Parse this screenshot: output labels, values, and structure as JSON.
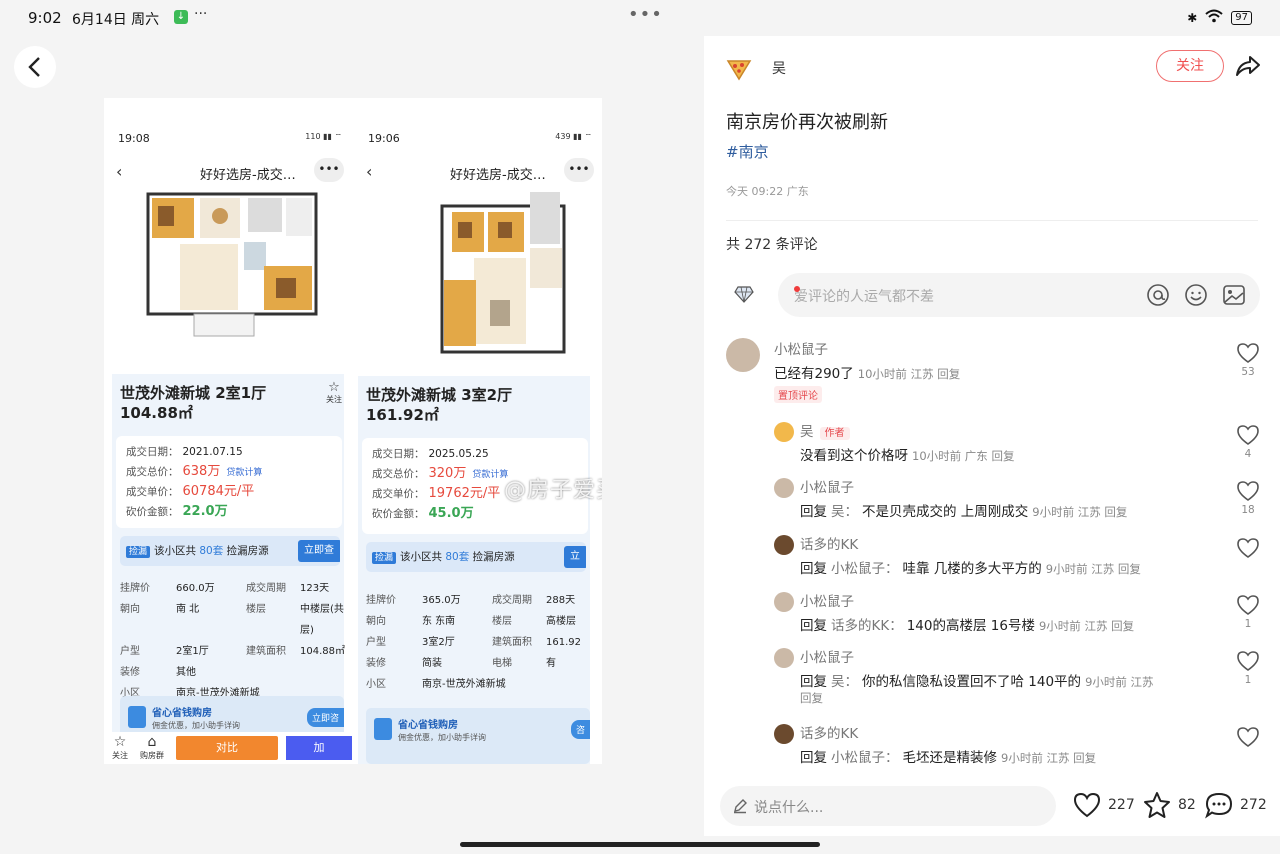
{
  "status_bar": {
    "time": "9:02",
    "date": "6月14日 周六",
    "battery": "97"
  },
  "left": {
    "watermark": "@房子爱买不买",
    "listing_a": {
      "time": "19:08",
      "signal": "110",
      "title": "好好选房-成交…",
      "name": "世茂外滩新城 2室1厅",
      "area": "104.88㎡",
      "follow": "关注",
      "deal_date_label": "成交日期：",
      "deal_date": "2021.07.15",
      "total_label": "成交总价：",
      "total": "638万",
      "loan": "贷款计算",
      "unit_label": "成交单价：",
      "unit": "60784元/平",
      "bargain_label": "砍价金额：",
      "bargain": "22.0万",
      "leak_tag": "捡漏",
      "leak_text_a": "该小区共",
      "leak_num": "80套",
      "leak_text_b": "捡漏房源",
      "leak_btn": "立即查",
      "rows": [
        {
          "k1": "挂牌价",
          "v1": "660.0万",
          "k2": "成交周期",
          "v2": "123天"
        },
        {
          "k1": "朝向",
          "v1": "南 北",
          "k2": "楼层",
          "v2": "中楼层(共"
        },
        {
          "k1": "",
          "v1": "",
          "k2": "",
          "v2": "层)"
        },
        {
          "k1": "户型",
          "v1": "2室1厅",
          "k2": "建筑面积",
          "v2": "104.88㎡"
        },
        {
          "k1": "装修",
          "v1": "其他",
          "k2": "",
          "v2": ""
        },
        {
          "k1": "小区",
          "v1": "南京-世茂外滩新城",
          "k2": "",
          "v2": ""
        }
      ],
      "save_title": "省心省钱购房",
      "save_sub": "佣金优惠，加小助手详询",
      "save_btn": "立即咨",
      "ba_follow": "关注",
      "ba_buy": "购房群",
      "ba_compare": "对比",
      "ba_add": "加"
    },
    "listing_b": {
      "time": "19:06",
      "signal": "439",
      "title": "好好选房-成交…",
      "name": "世茂外滩新城 3室2厅",
      "area": "161.92㎡",
      "deal_date_label": "成交日期：",
      "deal_date": "2025.05.25",
      "total_label": "成交总价：",
      "total": "320万",
      "loan": "贷款计算",
      "unit_label": "成交单价：",
      "unit": "19762元/平",
      "bargain_label": "砍价金额：",
      "bargain": "45.0万",
      "leak_tag": "捡漏",
      "leak_text_a": "该小区共",
      "leak_num": "80套",
      "leak_text_b": "捡漏房源",
      "leak_btn": "立",
      "rows": [
        {
          "k1": "挂牌价",
          "v1": "365.0万",
          "k2": "成交周期",
          "v2": "288天"
        },
        {
          "k1": "朝向",
          "v1": "东 东南",
          "k2": "楼层",
          "v2": "高楼层"
        },
        {
          "k1": "户型",
          "v1": "3室2厅",
          "k2": "建筑面积",
          "v2": "161.92"
        },
        {
          "k1": "装修",
          "v1": "简装",
          "k2": "电梯",
          "v2": "有"
        },
        {
          "k1": "小区",
          "v1": "南京-世茂外滩新城",
          "k2": "",
          "v2": ""
        }
      ],
      "save_title": "省心省钱购房",
      "save_sub": "佣金优惠，加小助手详询",
      "save_btn": "咨"
    }
  },
  "post": {
    "author": "吴",
    "follow_label": "关注",
    "title": "南京房价再次被刷新",
    "tag": "#南京",
    "time": "今天 09:22 广东",
    "comment_count": "共 272 条评论",
    "input_placeholder": "爱评论的人运气都不差"
  },
  "comments": [
    {
      "name": "小松鼠子",
      "text": "已经有290了",
      "meta": "10小时前 江苏  回复",
      "likes": "53",
      "badge": "置顶评论"
    },
    {
      "name": "吴",
      "author_badge": "作者",
      "text": "没看到这个价格呀",
      "meta": "10小时前 广东  回复",
      "likes": "4"
    },
    {
      "name": "小松鼠子",
      "prefix": "回复",
      "reply_to": "吴：",
      "text": "不是贝壳成交的 上周刚成交",
      "meta": "9小时前 江苏  回复",
      "likes": "18"
    },
    {
      "name": "话多的KK",
      "prefix": "回复",
      "reply_to": "小松鼠子：",
      "text": "哇靠 几楼的多大平方的",
      "meta": "9小时前 江苏  回复",
      "likes": ""
    },
    {
      "name": "小松鼠子",
      "prefix": "回复",
      "reply_to": "话多的KK：",
      "text": "140的高楼层 16号楼",
      "meta": "9小时前 江苏  回复",
      "likes": "1"
    },
    {
      "name": "小松鼠子",
      "prefix": "回复",
      "reply_to": "吴：",
      "text": "你的私信隐私设置回不了哈 140平的",
      "meta": "9小时前 江苏",
      "meta2": "回复",
      "likes": "1"
    },
    {
      "name": "话多的KK",
      "prefix": "回复",
      "reply_to": "小松鼠子：",
      "text": "毛坯还是精装修",
      "meta": "9小时前 江苏  回复",
      "likes": ""
    }
  ],
  "bottom": {
    "say_placeholder": "说点什么...",
    "likes": "227",
    "stars": "82",
    "comments": "272"
  },
  "colors": {
    "accent_red": "#f05050",
    "link_blue": "#2f5d9e",
    "price_red": "#e64a3d",
    "bargain_green": "#3aa655"
  }
}
